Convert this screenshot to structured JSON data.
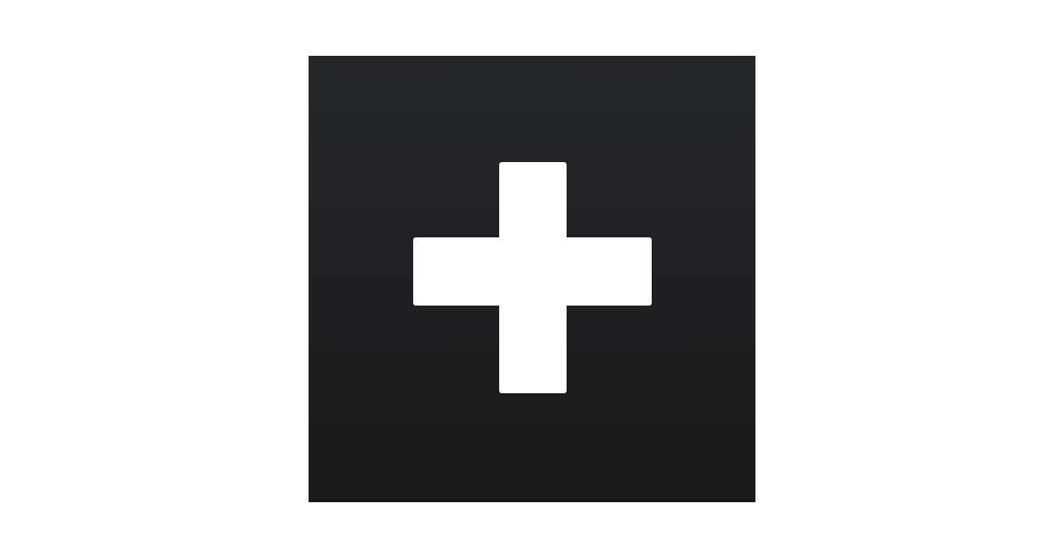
{
  "icon": {
    "name": "plus-icon",
    "background_top": "#24272c",
    "background_bottom": "#1a1a1b",
    "glyph_color": "#ffffff"
  },
  "page": {
    "background": "#ffffff"
  }
}
